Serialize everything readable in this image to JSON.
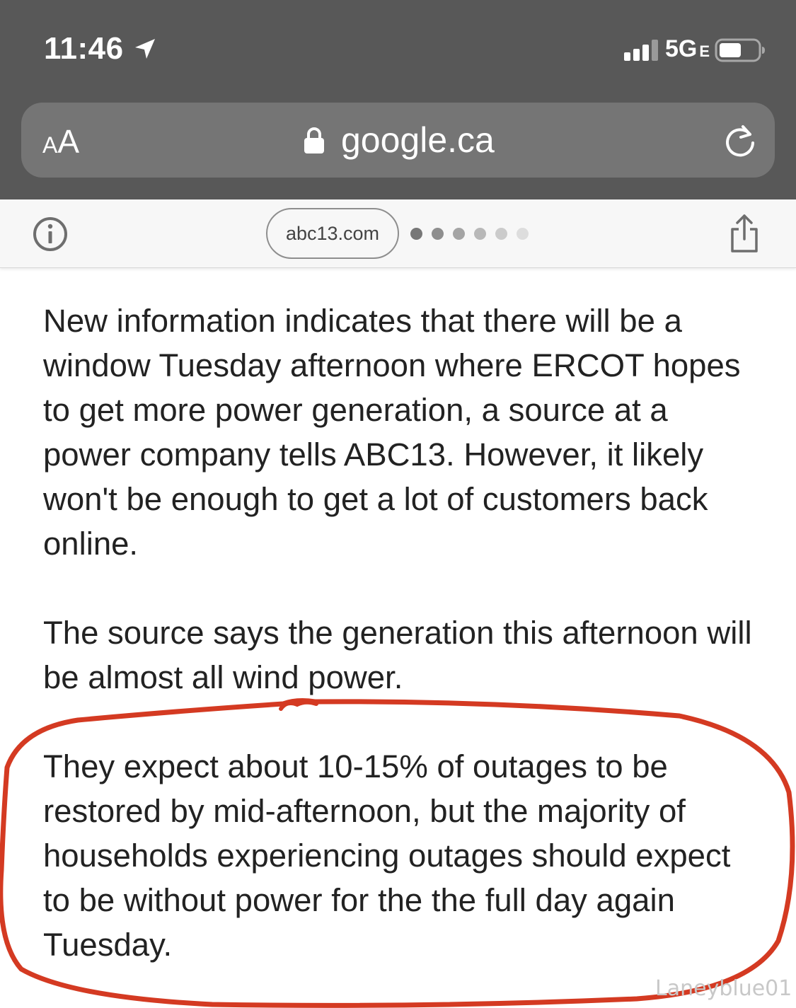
{
  "status_bar": {
    "time": "11:46",
    "network": "5G",
    "network_suffix": "E",
    "icons": [
      "location-arrow-icon",
      "cellular-signal-icon",
      "battery-icon"
    ]
  },
  "url_bar": {
    "text_size_small": "A",
    "text_size_large": "A",
    "domain": "google.ca",
    "icons": [
      "lock-icon",
      "reload-icon"
    ]
  },
  "amp_bar": {
    "source": "abc13.com",
    "page_dots": 6,
    "icons": [
      "info-icon",
      "share-icon"
    ]
  },
  "article": {
    "paragraphs": [
      "New information indicates that there will be a window Tuesday afternoon where ERCOT hopes to get more power generation, a source at a power company tells ABC13. However, it likely won't be enough to get a lot of customers back online.",
      "The source says the generation this afternoon will be almost all wind power.",
      "They expect about 10-15% of outages to be restored by mid-afternoon, but the majority of households experiencing outages should expect to be without power for the the full day again Tuesday."
    ]
  },
  "annotation": {
    "color": "#d43a22",
    "shape": "hand-drawn circle around third paragraph"
  },
  "watermark": "Laneyblue01",
  "colors": {
    "chrome": "#585858",
    "url_bar": "#757575",
    "amp_bar": "#f7f7f7",
    "text": "#222222"
  }
}
